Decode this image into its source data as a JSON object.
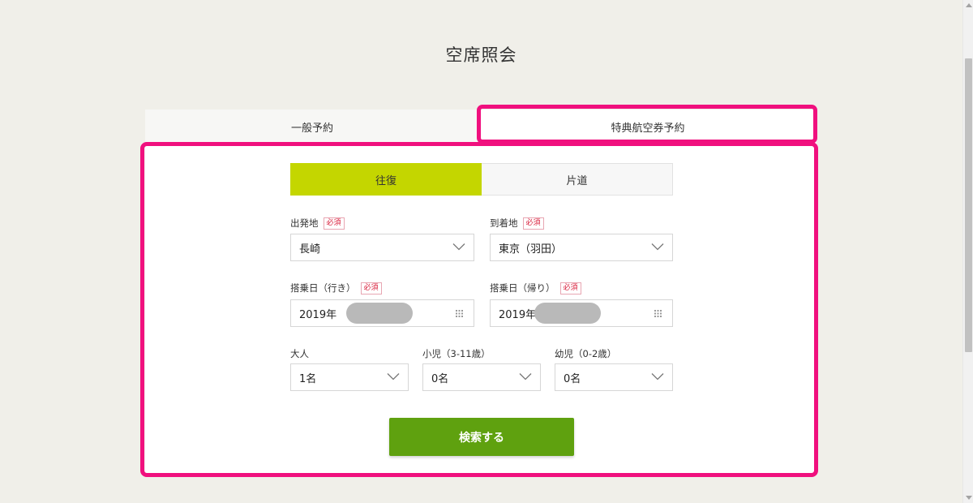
{
  "page": {
    "title": "空席照会"
  },
  "tabs": {
    "general": "一般予約",
    "award": "特典航空券予約"
  },
  "trip_type": {
    "round_trip": "往復",
    "one_way": "片道",
    "selected": "往復"
  },
  "required_badge": "必須",
  "departure": {
    "label": "出発地",
    "value": "長崎"
  },
  "arrival": {
    "label": "到着地",
    "value": "東京（羽田）"
  },
  "outbound_date": {
    "label": "搭乗日（行き）",
    "value": "2019年"
  },
  "return_date": {
    "label": "搭乗日（帰り）",
    "value": "2019年"
  },
  "passengers": {
    "adult": {
      "label": "大人",
      "value": "1名"
    },
    "child": {
      "label": "小児（3-11歳）",
      "value": "0名"
    },
    "infant": {
      "label": "幼児（0-2歳）",
      "value": "0名"
    }
  },
  "search_button": "検索する",
  "colors": {
    "highlight": "#f0107e",
    "round_trip_active": "#c4d600",
    "search_button": "#5fa10f",
    "required": "#d81b38"
  },
  "icons": {
    "select": "chevron-down-icon",
    "date": "calendar-icon"
  }
}
